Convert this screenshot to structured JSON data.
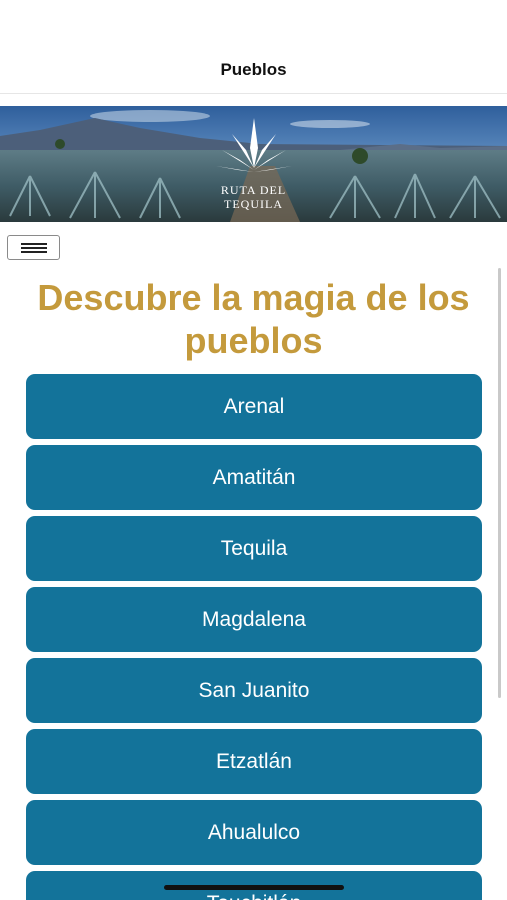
{
  "navbar": {
    "title": "Pueblos"
  },
  "banner": {
    "logo_line1": "RUTA DEL",
    "logo_line2": "TEQUILA",
    "logo_icon": "agave-icon"
  },
  "menu": {
    "icon": "hamburger-icon"
  },
  "headline": "Descubre la magia de los pueblos",
  "towns": [
    {
      "label": "Arenal"
    },
    {
      "label": "Amatitán"
    },
    {
      "label": "Tequila"
    },
    {
      "label": "Magdalena"
    },
    {
      "label": "San Juanito"
    },
    {
      "label": "Etzatlán"
    },
    {
      "label": "Ahualulco"
    },
    {
      "label": "Teuchitlán"
    }
  ],
  "colors": {
    "accent_gold": "#c49a3c",
    "button_blue": "#13739a"
  }
}
